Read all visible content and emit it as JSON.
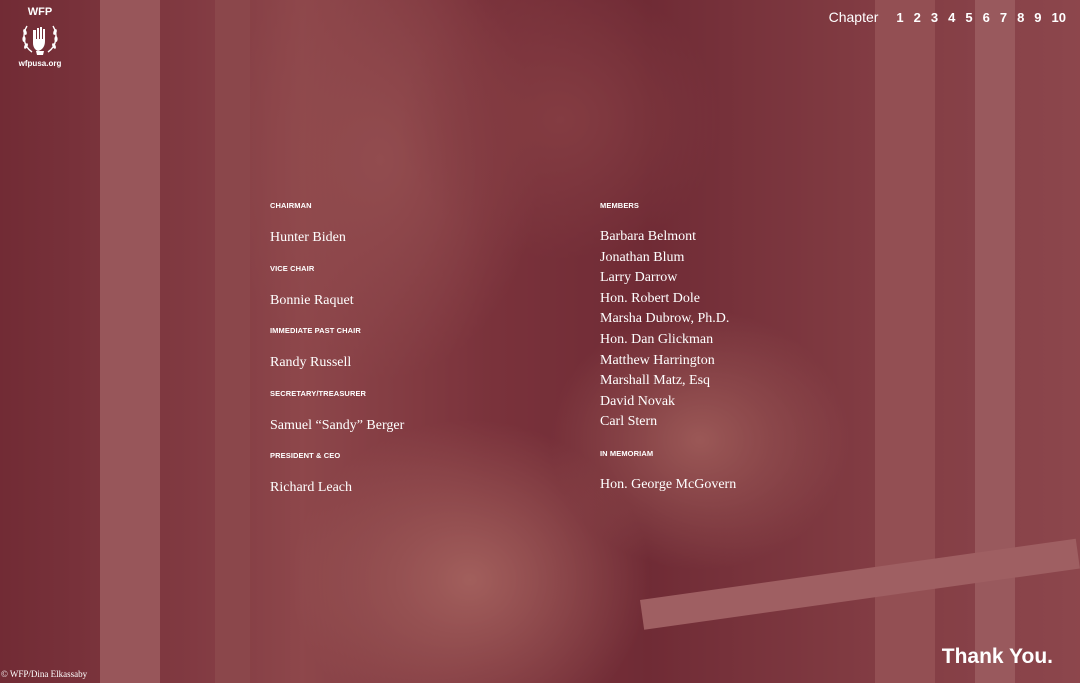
{
  "logo": {
    "abbr": "WFP",
    "url": "wfpusa.org",
    "icon": "wfp-emblem-icon"
  },
  "nav": {
    "label": "Chapter",
    "chapters": [
      "1",
      "2",
      "3",
      "4",
      "5",
      "6",
      "7",
      "8",
      "9",
      "10"
    ]
  },
  "board": {
    "left": [
      {
        "role": "CHAIRMAN",
        "name": "Hunter Biden"
      },
      {
        "role": "VICE CHAIR",
        "name": "Bonnie Raquet"
      },
      {
        "role": "IMMEDIATE PAST CHAIR",
        "name": "Randy Russell"
      },
      {
        "role": "SECRETARY/TREASURER",
        "name": "Samuel “Sandy” Berger"
      },
      {
        "role": "PRESIDENT & CEO",
        "name": "Richard Leach"
      }
    ],
    "members_heading": "MEMBERS",
    "members": [
      "Barbara Belmont",
      "Jonathan Blum",
      "Larry Darrow",
      "Hon. Robert Dole",
      "Marsha Dubrow, Ph.D.",
      "Hon. Dan Glickman",
      "Matthew Harrington",
      "Marshall Matz, Esq",
      "David Novak",
      "Carl Stern"
    ],
    "memoriam_heading": "IN MEMORIAM",
    "memoriam_name": "Hon. George McGovern"
  },
  "photo_credit": "© WFP/Dina Elkassaby",
  "thanks": "Thank You."
}
